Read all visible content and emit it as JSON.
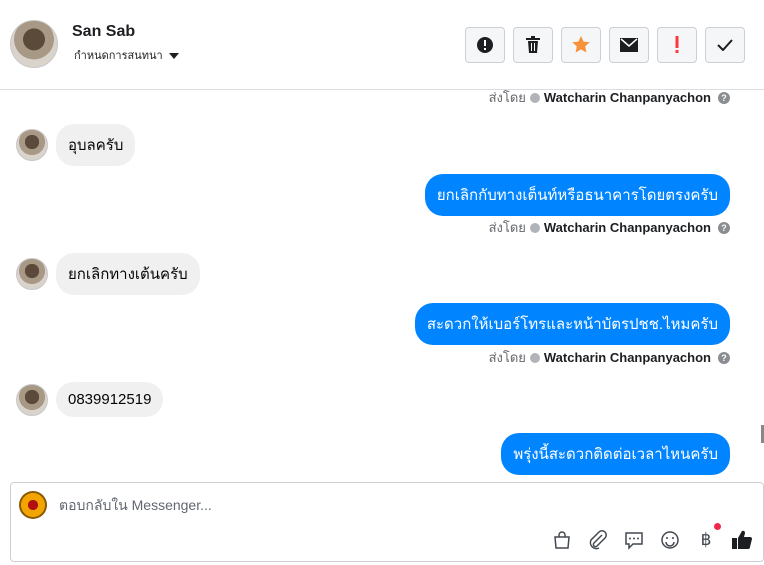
{
  "header": {
    "name": "San Sab",
    "subtitle": "กำหนดการสนทนา",
    "actions": [
      "alert-icon",
      "trash-icon",
      "star-icon",
      "mail-icon",
      "exclamation-icon",
      "check-icon"
    ]
  },
  "colors": {
    "brand_blue": "#0084ff",
    "star": "#f7923b",
    "red": "#fa383e",
    "incoming_bg": "#f0f0f0"
  },
  "messages": [
    {
      "type": "sent_by",
      "prefix": "ส่งโดย",
      "author": "Watcharin Chanpanyachon"
    },
    {
      "type": "incoming",
      "text": "อุบลครับ"
    },
    {
      "type": "outgoing",
      "text": "ยกเลิกกับทางเต็นท์หรือธนาคารโดยตรงครับ"
    },
    {
      "type": "sent_by",
      "prefix": "ส่งโดย",
      "author": "Watcharin Chanpanyachon"
    },
    {
      "type": "incoming",
      "text": "ยกเลิกทางเต้นครับ"
    },
    {
      "type": "outgoing",
      "text": "สะดวกให้เบอร์โทรและหน้าบัตรปชช.ไหมครับ"
    },
    {
      "type": "sent_by",
      "prefix": "ส่งโดย",
      "author": "Watcharin Chanpanyachon"
    },
    {
      "type": "incoming",
      "text": "0839912519"
    },
    {
      "type": "outgoing",
      "text": "พรุ่งนี้สะดวกติดต่อเวลาไหนครับ"
    }
  ],
  "composer": {
    "placeholder": "ตอบกลับใน Messenger...",
    "tools": [
      "shopping-bag-icon",
      "paperclip-icon",
      "chat-bubble-icon",
      "smiley-icon",
      "baht-icon",
      "thumbs-up-icon"
    ]
  }
}
